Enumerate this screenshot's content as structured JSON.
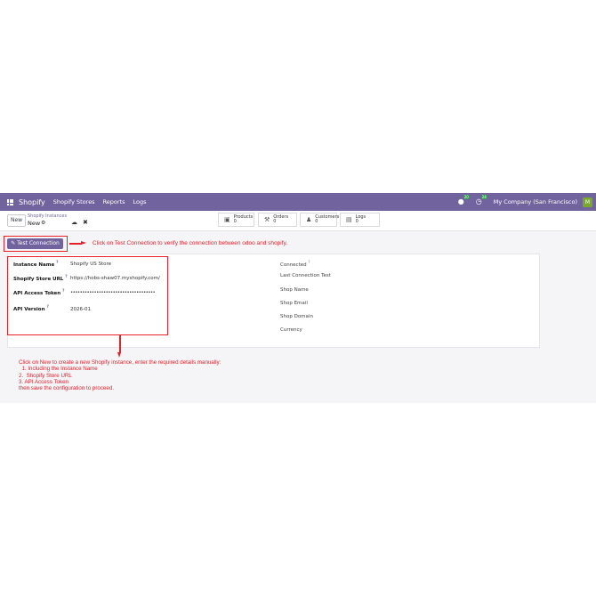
{
  "topbar": {
    "brand": "Shopify",
    "menu": [
      "Shopify Stores",
      "Reports",
      "Logs"
    ],
    "chat_badge": "20",
    "activity_badge": "24",
    "company": "My Company (San Francisco)"
  },
  "controlbar": {
    "new_label": "New",
    "breadcrumb_parent": "Shopify Instances",
    "breadcrumb_current": "New"
  },
  "smart_buttons": [
    {
      "label": "Products",
      "count": "0",
      "icon": "cube-icon"
    },
    {
      "label": "Orders",
      "count": "0",
      "icon": "cart-icon"
    },
    {
      "label": "Customers",
      "count": "0",
      "icon": "users-icon"
    },
    {
      "label": "Logs",
      "count": "0",
      "icon": "log-icon"
    }
  ],
  "actions": {
    "test_connection": "Test Connection"
  },
  "form": {
    "left": [
      {
        "label": "Instance Name",
        "value": "Shopify US Store",
        "required": "?"
      },
      {
        "label": "Shopify Store URL",
        "value": "https://hobs-shaw07.myshopify.com/",
        "required": "?"
      },
      {
        "label": "API Access Token",
        "value": "••••••••••••••••••••••••••••••••••••",
        "required": "?"
      },
      {
        "label": "API Version",
        "value": "2026-01",
        "required": "?"
      }
    ],
    "right": [
      {
        "label": "Connected",
        "required": "?"
      },
      {
        "label": "Last Connection Test"
      },
      {
        "label": "Shop Name"
      },
      {
        "label": "Shop Email"
      },
      {
        "label": "Shop Domain"
      },
      {
        "label": "Currency"
      }
    ]
  },
  "annotations": {
    "test_note": "Click on Test Connection to verify the connection between odoo and shopify.",
    "new_note": [
      "Click on New to create a new Shopify instance, enter the required details manually:",
      "  1. Including the Instance Name",
      "2.  Shopify Store URL",
      "3. API Access Token",
      "then save the configuration to proceed."
    ],
    "color": "#e8202a"
  },
  "colors": {
    "brand": "#71639e"
  }
}
